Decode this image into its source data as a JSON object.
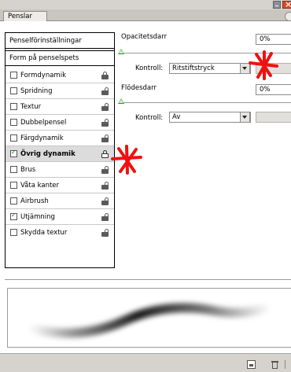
{
  "window": {
    "tab_label": "Penslar"
  },
  "sidebar": {
    "presets_label": "Penselförinställningar",
    "tipshape_label": "Form på penselspets",
    "items": [
      {
        "label": "Formdynamik",
        "checked": false,
        "selected": false,
        "lock": "closed"
      },
      {
        "label": "Spridning",
        "checked": false,
        "selected": false,
        "lock": "open"
      },
      {
        "label": "Textur",
        "checked": false,
        "selected": false,
        "lock": "open"
      },
      {
        "label": "Dubbelpensel",
        "checked": false,
        "selected": false,
        "lock": "open"
      },
      {
        "label": "Färgdynamik",
        "checked": false,
        "selected": false,
        "lock": "open"
      },
      {
        "label": "Övrig dynamik",
        "checked": true,
        "selected": true,
        "lock": "outline"
      },
      {
        "label": "Brus",
        "checked": false,
        "selected": false,
        "lock": "open"
      },
      {
        "label": "Våta kanter",
        "checked": false,
        "selected": false,
        "lock": "open"
      },
      {
        "label": "Airbrush",
        "checked": false,
        "selected": false,
        "lock": "open"
      },
      {
        "label": "Utjämning",
        "checked": true,
        "selected": false,
        "lock": "open"
      },
      {
        "label": "Skydda textur",
        "checked": false,
        "selected": false,
        "lock": "open"
      }
    ]
  },
  "opacity": {
    "label": "Opacitetsdarr",
    "value": "0%",
    "slider_percent": 0,
    "control_label": "Kontroll:",
    "control_value": "Ritstiftstryck"
  },
  "flow": {
    "label": "Flödesdarr",
    "value": "0%",
    "slider_percent": 0,
    "control_label": "Kontroll:",
    "control_value": "Av"
  },
  "colors": {
    "annotation_red": "#ee1111",
    "slider_green": "#2e8f2e",
    "panel_bg": "#ffffff"
  },
  "icons": {
    "new_preset": "new-preset-icon",
    "delete": "trash-icon"
  }
}
